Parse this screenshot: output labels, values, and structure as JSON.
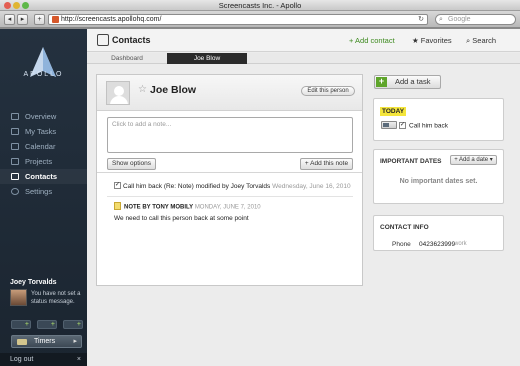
{
  "window": {
    "title": "Screencasts Inc. - Apollo"
  },
  "browser": {
    "url": "http://screencasts.apollohq.com/",
    "search_placeholder": "Google"
  },
  "sidebar": {
    "logo_text": "APOLLO",
    "items": [
      {
        "label": "Overview",
        "icon": "overview-icon",
        "active": false
      },
      {
        "label": "My Tasks",
        "icon": "checkbox-icon",
        "active": false
      },
      {
        "label": "Calendar",
        "icon": "calendar-icon",
        "active": false
      },
      {
        "label": "Projects",
        "icon": "folder-icon",
        "active": false
      },
      {
        "label": "Contacts",
        "icon": "contacts-icon",
        "active": true
      },
      {
        "label": "Settings",
        "icon": "gear-icon",
        "active": false
      }
    ],
    "user": {
      "name": "Joey Torvalds",
      "status": "You have not set a status message."
    },
    "quick_add": [
      "+",
      "+",
      "+"
    ],
    "timers_label": "Timers",
    "logout_label": "Log out",
    "logout_close": "×"
  },
  "topbar": {
    "title": "Contacts",
    "add_contact": "+ Add contact",
    "favorites": "★ Favorites",
    "search": "Search"
  },
  "tabs": [
    {
      "label": "Dashboard",
      "active": false
    },
    {
      "label": "Joe Blow",
      "active": true
    }
  ],
  "contact": {
    "name": "Joe Blow",
    "edit_label": "Edit this person",
    "note_placeholder": "Click to add a note...",
    "show_options": "Show options",
    "add_note": "+ Add this note",
    "feed": {
      "task_text": "Call him back (Re: Note) modified by Joey Torvalds",
      "task_date": "Wednesday, June 16, 2010",
      "note_by": "NOTE BY TONY MOBILY",
      "note_date": "MONDAY, JUNE 7, 2010",
      "note_body": "We need to call this person back at some point"
    }
  },
  "tasks": {
    "add_task": "Add a task",
    "today_label": "TODAY",
    "task": "Call him back"
  },
  "important_dates": {
    "title": "IMPORTANT DATES",
    "add_label": "+ Add a date ▾",
    "empty": "No important dates set."
  },
  "contact_info": {
    "title": "CONTACT INFO",
    "phone_label": "Phone",
    "phone_value": "0423623999",
    "phone_type": "work"
  },
  "colors": {
    "sidebar_bg": "#1f2b37",
    "accent_green": "#5fa52b",
    "today_badge": "#f4e53b",
    "active_tab": "#2b2b2b"
  }
}
